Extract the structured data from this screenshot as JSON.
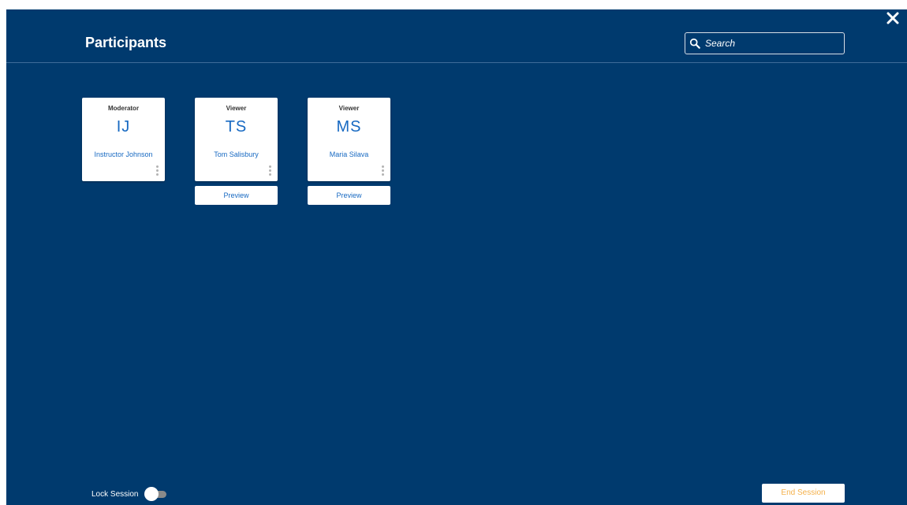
{
  "header": {
    "title": "Participants",
    "search": {
      "placeholder": "Search",
      "icon": "search-icon"
    },
    "close_icon": "close-icon"
  },
  "participants": [
    {
      "role": "Moderator",
      "initials": "IJ",
      "name": "Instructor Johnson",
      "action": null
    },
    {
      "role": "Viewer",
      "initials": "TS",
      "name": "Tom Salisbury",
      "action": "Preview"
    },
    {
      "role": "Viewer",
      "initials": "MS",
      "name": "Maria Silava",
      "action": "Preview"
    }
  ],
  "footer": {
    "lock_label": "Lock Session",
    "lock_enabled": false,
    "end_label": "End Session"
  },
  "colors": {
    "background": "#003a6e",
    "accent": "#1769c2",
    "end_session_text": "#f4b04a"
  }
}
